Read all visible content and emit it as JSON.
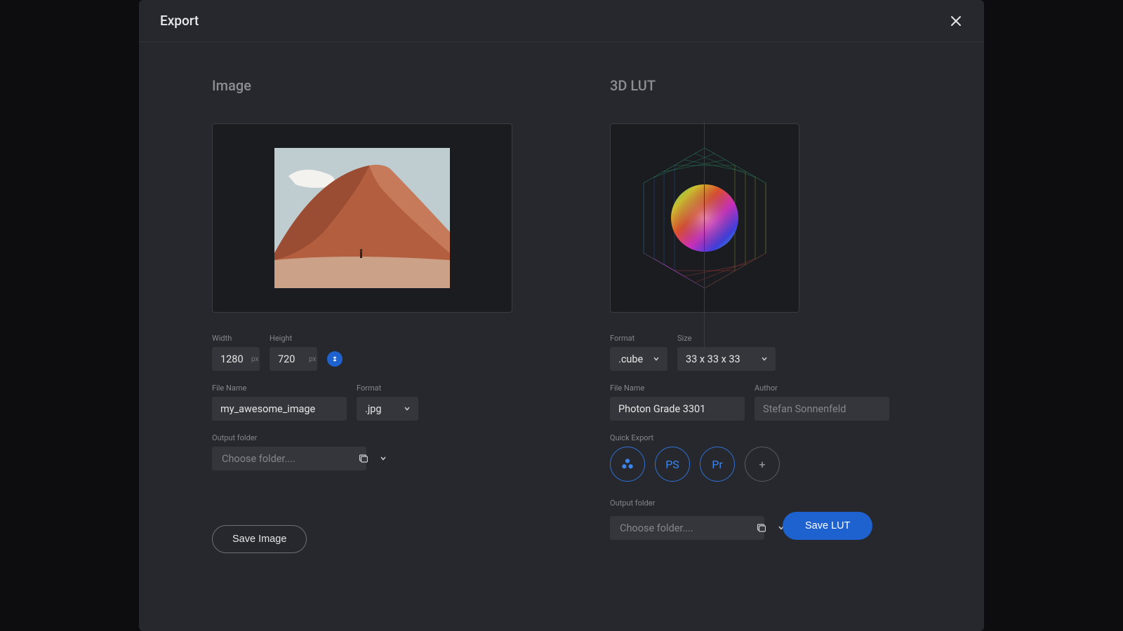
{
  "dialog": {
    "title": "Export"
  },
  "image": {
    "heading": "Image",
    "width_label": "Width",
    "height_label": "Height",
    "width_value": "1280",
    "height_value": "720",
    "px_unit": "px",
    "filename_label": "File Name",
    "filename_value": "my_awesome_image",
    "format_label": "Format",
    "format_value": ".jpg",
    "output_label": "Output folder",
    "output_placeholder": "Choose folder....",
    "save_label": "Save Image"
  },
  "lut": {
    "heading": "3D LUT",
    "format_label": "Format",
    "format_value": ".cube",
    "size_label": "Size",
    "size_value": "33 x 33 x 33",
    "filename_label": "File Name",
    "filename_value": "Photon Grade 3301",
    "author_label": "Author",
    "author_placeholder": "Stefan Sonnenfeld",
    "quick_label": "Quick Export",
    "quick": {
      "ps": "PS",
      "pr": "Pr",
      "add": "+"
    },
    "output_label": "Output folder",
    "output_placeholder": "Choose folder....",
    "save_label": "Save LUT"
  }
}
